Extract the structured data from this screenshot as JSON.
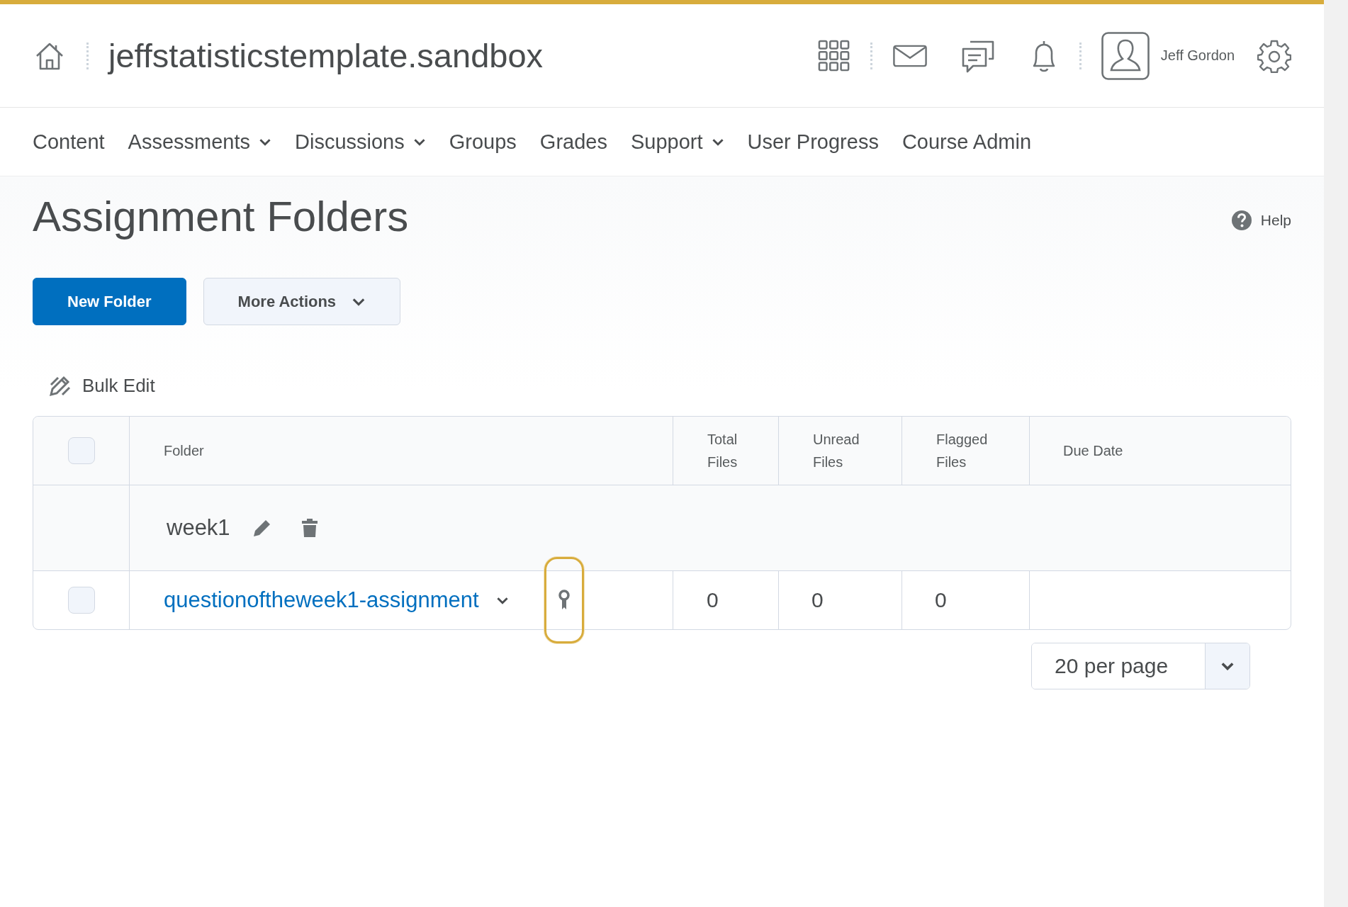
{
  "header": {
    "site_title": "jeffstatisticstemplate.sandbox",
    "user_name": "Jeff Gordon"
  },
  "nav": [
    {
      "label": "Content",
      "has_menu": false
    },
    {
      "label": "Assessments",
      "has_menu": true
    },
    {
      "label": "Discussions",
      "has_menu": true
    },
    {
      "label": "Groups",
      "has_menu": false
    },
    {
      "label": "Grades",
      "has_menu": false
    },
    {
      "label": "Support",
      "has_menu": true
    },
    {
      "label": "User Progress",
      "has_menu": false
    },
    {
      "label": "Course Admin",
      "has_menu": false
    }
  ],
  "page_title": "Assignment Folders",
  "help": "Help",
  "actions": {
    "primary": "New Folder",
    "more": "More Actions"
  },
  "bulk_edit": "Bulk Edit",
  "table": {
    "select_all_checked": false,
    "columns": [
      "Folder",
      "Total Files",
      "Unread Files",
      "Flagged Files",
      "Due Date"
    ],
    "categories": [
      {
        "name": "week1",
        "rows": [
          {
            "name": "questionoftheweek1-assignment",
            "checked": false,
            "badge_focused": true,
            "total_files": "0",
            "unread_files": "0",
            "flagged_files": "0"
          }
        ]
      }
    ]
  },
  "pager": {
    "value": "20 per page"
  }
}
